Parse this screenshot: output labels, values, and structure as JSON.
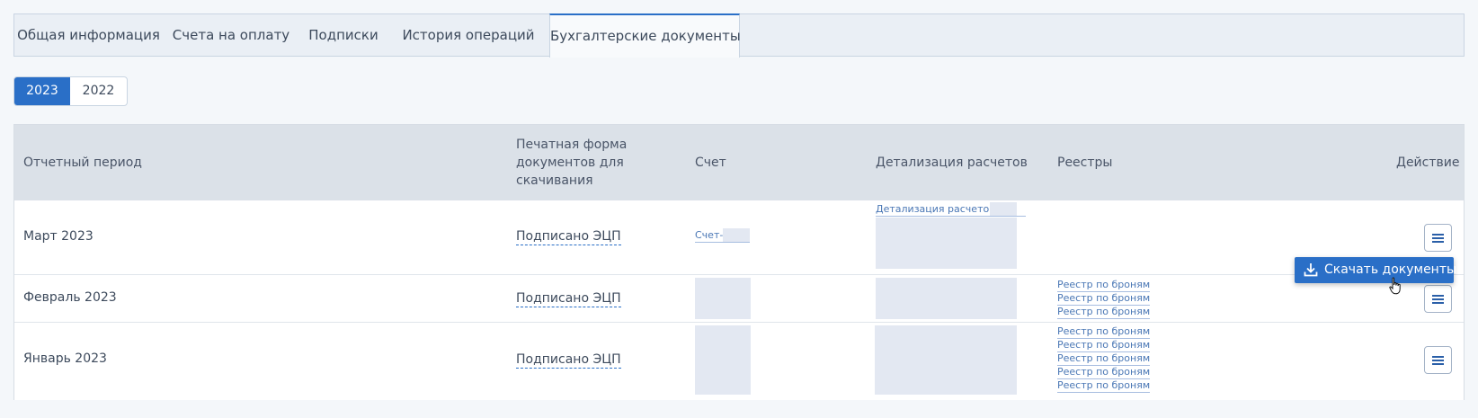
{
  "tabs": [
    {
      "label": "Общая информация"
    },
    {
      "label": "Счета на оплату"
    },
    {
      "label": "Подписки"
    },
    {
      "label": "История операций"
    },
    {
      "label": "Бухгалтерские документы"
    }
  ],
  "years": [
    "2023",
    "2022"
  ],
  "table": {
    "headers": {
      "period": "Отчетный период",
      "print_form": "Печатная форма документов для скачивания",
      "invoice": "Счет",
      "details": "Детализация расчетов",
      "registries": "Реестры",
      "action": "Действие"
    },
    "rows": [
      {
        "period": "Март 2023",
        "print_form": "Подписано ЭЦП",
        "invoice_link": "Счет-",
        "details_link": "Детализация расчетов-",
        "registries": []
      },
      {
        "period": "Февраль 2023",
        "print_form": "Подписано ЭЦП",
        "registries": [
          "Реестр по броням",
          "Реестр по броням",
          "Реестр по броням"
        ]
      },
      {
        "period": "Январь 2023",
        "print_form": "Подписано ЭЦП",
        "registries": [
          "Реестр по броням",
          "Реестр по броням",
          "Реестр по броням",
          "Реестр по броням",
          "Реестр по броням"
        ]
      }
    ]
  },
  "dropdown": {
    "download_label": "Скачать документы"
  },
  "icons": {
    "menu": "hamburger-menu-icon",
    "download": "download-icon",
    "cursor": "hand-pointer-cursor-icon"
  },
  "colors": {
    "accent": "#2a6fc7",
    "header_bg": "#dbe1e8",
    "page_bg": "#f4f7fa"
  }
}
